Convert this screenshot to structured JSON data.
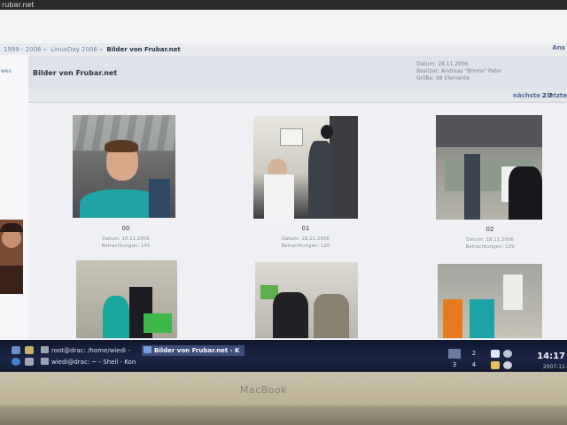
{
  "window": {
    "title": "rubar.net"
  },
  "breadcrumb": {
    "items": [
      "1999 - 2006",
      "LinuxDay 2006"
    ],
    "current": "Bilder von Frubar.net"
  },
  "top_right_link": "Ans",
  "left_link": "wes",
  "album": {
    "title": "Bilder von Frubar.net",
    "meta": [
      "Datum: 28.11.2006",
      "Besitzer: Andreas \"Broms\" Pater",
      "Größe: 98 Elemente"
    ]
  },
  "pager": {
    "next_label": "nächste",
    "pages": "2 2",
    "last_label": "letzte"
  },
  "photos": [
    {
      "number": "00",
      "date": "Datum: 18.11.2006",
      "views": "Betrachtungen: 145"
    },
    {
      "number": "01",
      "date": "Datum: 18.11.2006",
      "views": "Betrachtungen: 120"
    },
    {
      "number": "02",
      "date": "Datum: 18.11.2006",
      "views": "Betrachtungen: 129"
    }
  ],
  "taskbar": {
    "tasks": [
      {
        "label": "root@drac: /home/wiedi - "
      },
      {
        "label": "Bilder von Frubar.net - K"
      },
      {
        "label": "wiedi@drac: ~ - Shell - Kon"
      }
    ],
    "desktops": [
      "2",
      "3",
      "4"
    ],
    "clock": "14:17",
    "date": "2007-11-"
  },
  "bezel": {
    "label": "MacBook"
  },
  "colors": {
    "link": "#6a86a8",
    "panel": "#dfe3e9",
    "taskbar": "#1c2644",
    "bezel": "#c9c0a9"
  }
}
